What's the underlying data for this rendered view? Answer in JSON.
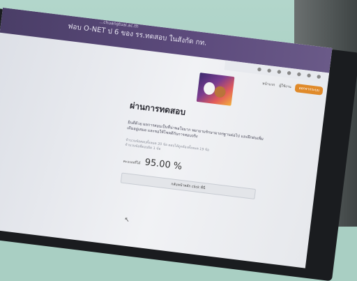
{
  "header": {
    "title": "ฟอบ O-NET ป 6 ของ รร.ทดสอบ ในสังกัด กท.",
    "title_small": "...chuangtuai.ac.th",
    "nav": {
      "link": "หน้าแรก",
      "user": "ผู้ใช้งาน",
      "button": "ออกจากระบบ"
    },
    "browser_icons": "● ● ● ● ● ● ●"
  },
  "main": {
    "banner_icon": "cartoon-banner-icon",
    "title": "ผ่านการทดสอบ",
    "result_message": "ยินดีด้วย ผลการสอบเป็นที่น่าพอใจมาก พยายามรักษามาตรฐานต่อไป และฝึกฝนเพิ่มเติมอยู่เสมอ และขอให้โชคดีกับการสอบจริง",
    "info_line_1": "จำนวนข้อสอบทั้งหมด 20 ข้อ ตอบได้ถูกต้องทั้งหมด 19 ข้อ",
    "info_line_2": "จำนวนข้อที่ตอบผิด 1 ข้อ",
    "score_label": "คะแนนที่ได้",
    "score_value": "95.00 %",
    "action_button": "กลับหน้าหลัก click ที่นี่"
  },
  "colors": {
    "header_bg": "#4a3e67",
    "accent": "#e08a2a"
  }
}
